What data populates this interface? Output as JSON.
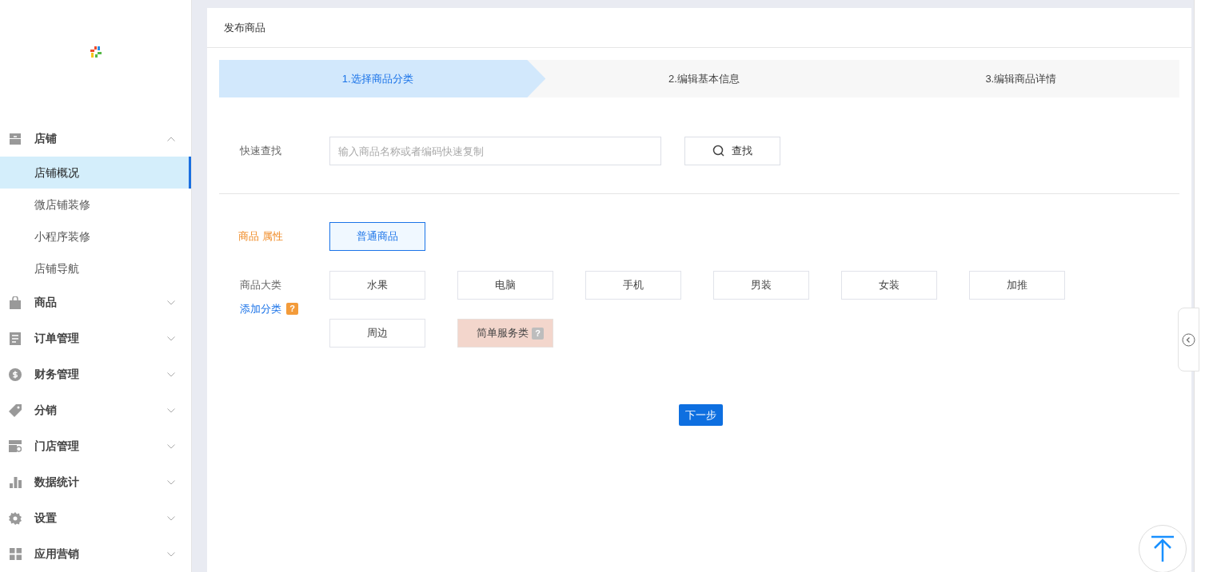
{
  "sidebar": {
    "groups": [
      {
        "label": "店铺",
        "expanded": true,
        "items": [
          {
            "label": "店铺概况",
            "selected": true
          },
          {
            "label": "微店铺装修",
            "selected": false
          },
          {
            "label": "小程序装修",
            "selected": false
          },
          {
            "label": "店铺导航",
            "selected": false
          }
        ]
      },
      {
        "label": "商品",
        "expanded": false
      },
      {
        "label": "订单管理",
        "expanded": false
      },
      {
        "label": "财务管理",
        "expanded": false
      },
      {
        "label": "分销",
        "expanded": false
      },
      {
        "label": "门店管理",
        "expanded": false
      },
      {
        "label": "数据统计",
        "expanded": false
      },
      {
        "label": "设置",
        "expanded": false
      },
      {
        "label": "应用营销",
        "expanded": false
      }
    ]
  },
  "page": {
    "title": "发布商品",
    "steps": [
      {
        "label": "1.选择商品分类",
        "selected": true
      },
      {
        "label": "2.编辑基本信息",
        "selected": false
      },
      {
        "label": "3.编辑商品详情",
        "selected": false
      }
    ],
    "quick_search": {
      "label": "快速查找",
      "placeholder": "输入商品名称或者编码快速复制",
      "button": "查找"
    },
    "attribute": {
      "label": "商品 属性",
      "options": [
        {
          "label": "普通商品",
          "selected": true
        }
      ]
    },
    "category": {
      "label": "商品大类",
      "add_link": "添加分类",
      "add_help": "?",
      "options": [
        {
          "label": "水果",
          "highlighted": false
        },
        {
          "label": "电脑",
          "highlighted": false
        },
        {
          "label": "手机",
          "highlighted": false
        },
        {
          "label": "男装",
          "highlighted": false
        },
        {
          "label": "女装",
          "highlighted": false
        },
        {
          "label": "加推",
          "highlighted": false
        },
        {
          "label": "周边",
          "highlighted": false
        },
        {
          "label": "简单服务类",
          "highlighted": true,
          "help": "?"
        }
      ]
    },
    "next_button": "下一步"
  }
}
